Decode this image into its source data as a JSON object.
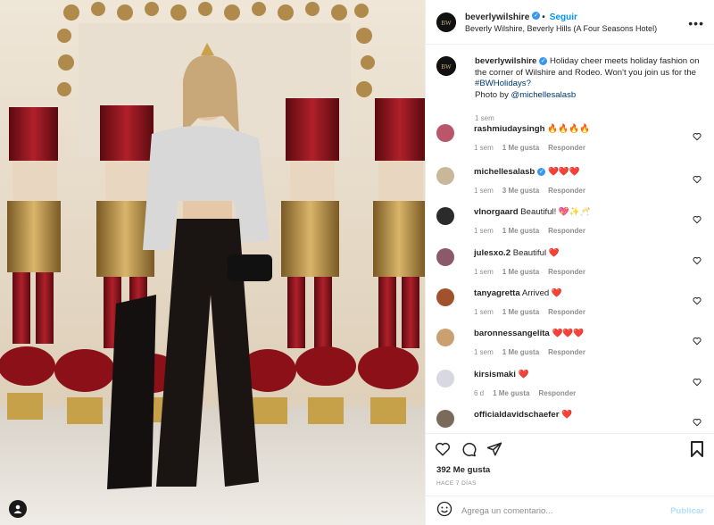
{
  "post": {
    "account": "beverlywilshire",
    "follow_label": "Seguir",
    "location": "Beverly Wilshire, Beverly Hills (A Four Seasons Hotel)",
    "caption_text": "Holiday cheer meets holiday fashion on the corner of Wilshire and Rodeo. Won't you join us for the",
    "caption_hashtag": "#BWHolidays?",
    "caption_photo_by": "Photo by",
    "caption_mention": "@michellesalasb",
    "caption_time": "1 sem"
  },
  "comments": [
    {
      "user": "rashmiudaysingh",
      "text": "🔥🔥🔥🔥",
      "time": "1 sem",
      "likes": "1 Me gusta",
      "reply": "Responder",
      "verified": false,
      "avatar_color": "#b9566a"
    },
    {
      "user": "michellesalasb",
      "text": "❤️❤️❤️",
      "time": "1 sem",
      "likes": "3 Me gusta",
      "reply": "Responder",
      "verified": true,
      "avatar_color": "#c9b79a"
    },
    {
      "user": "vlnorgaard",
      "text": "Beautiful! 💖✨🥂",
      "time": "1 sem",
      "likes": "1 Me gusta",
      "reply": "Responder",
      "verified": false,
      "avatar_color": "#2b2b2b"
    },
    {
      "user": "julesxo.2",
      "text": "Beautiful ❤️",
      "time": "1 sem",
      "likes": "1 Me gusta",
      "reply": "Responder",
      "verified": false,
      "avatar_color": "#8a5a6a"
    },
    {
      "user": "tanyagretta",
      "text": "Arrived ❤️",
      "time": "1 sem",
      "likes": "1 Me gusta",
      "reply": "Responder",
      "verified": false,
      "avatar_color": "#a0522d"
    },
    {
      "user": "baronnessangelita",
      "text": "❤️❤️❤️",
      "time": "1 sem",
      "likes": "1 Me gusta",
      "reply": "Responder",
      "verified": false,
      "avatar_color": "#caa070"
    },
    {
      "user": "kirsismaki",
      "text": "❤️",
      "time": "6 d",
      "likes": "1 Me gusta",
      "reply": "Responder",
      "verified": false,
      "avatar_color": "#d8d8e0"
    },
    {
      "user": "officialdavidschaefer",
      "text": "❤️",
      "time": "",
      "likes": "",
      "reply": "",
      "verified": false,
      "avatar_color": "#7a6a5a"
    }
  ],
  "footer": {
    "likes": "392 Me gusta",
    "posted_ago": "HACE 7 DÍAS",
    "comment_placeholder": "Agrega un comentario...",
    "publish_label": "Publicar"
  },
  "icons": {
    "like": "heart-icon",
    "comment": "comment-icon",
    "share": "share-icon",
    "save": "bookmark-icon",
    "emoji": "emoji-icon",
    "more": "more-icon",
    "verified": "verified-badge-icon",
    "user_tag": "user-tag-icon"
  },
  "colors": {
    "accent": "#0095f6",
    "verified": "#3897f0",
    "muted": "#8e8e8e",
    "hashtag": "#00376b"
  }
}
